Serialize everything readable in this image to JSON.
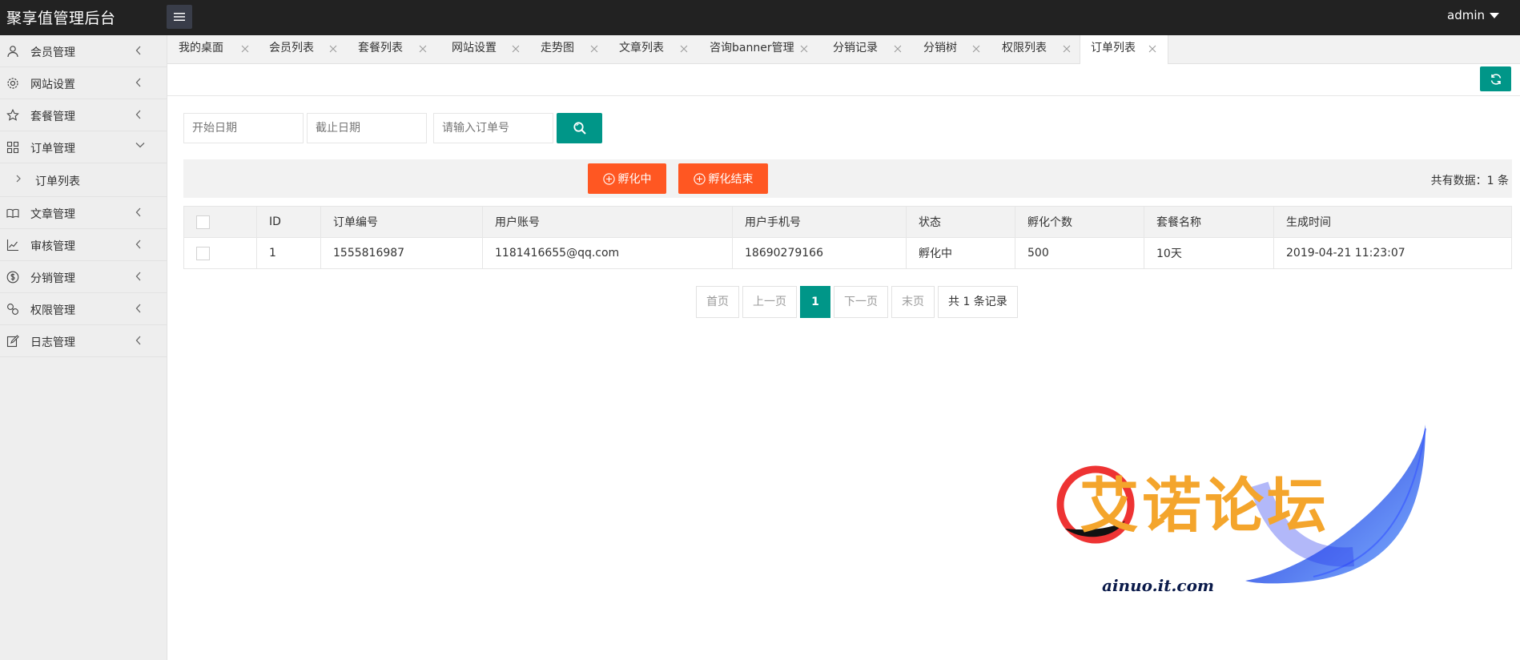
{
  "header": {
    "title": "聚享值管理后台",
    "user": "admin"
  },
  "sidebar": {
    "items": [
      {
        "label": "会员管理",
        "icon": "user-icon"
      },
      {
        "label": "网站设置",
        "icon": "gear-icon"
      },
      {
        "label": "套餐管理",
        "icon": "star-icon"
      },
      {
        "label": "订单管理",
        "icon": "grid-icon",
        "expanded": true
      },
      {
        "label": "文章管理",
        "icon": "book-icon"
      },
      {
        "label": "审核管理",
        "icon": "chart-icon"
      },
      {
        "label": "分销管理",
        "icon": "dollar-icon"
      },
      {
        "label": "权限管理",
        "icon": "link-icon"
      },
      {
        "label": "日志管理",
        "icon": "edit-icon"
      }
    ],
    "sub": {
      "label": "订单列表"
    }
  },
  "tabs": [
    {
      "label": "我的桌面"
    },
    {
      "label": "会员列表"
    },
    {
      "label": "套餐列表"
    },
    {
      "label": "网站设置"
    },
    {
      "label": "走势图"
    },
    {
      "label": "文章列表"
    },
    {
      "label": "咨询banner管理"
    },
    {
      "label": "分销记录"
    },
    {
      "label": "分销树"
    },
    {
      "label": "权限列表"
    },
    {
      "label": "订单列表",
      "active": true
    }
  ],
  "search": {
    "start_placeholder": "开始日期",
    "end_placeholder": "截止日期",
    "order_placeholder": "请输入订单号"
  },
  "actions": {
    "incubating": "孵化中",
    "finished": "孵化结束",
    "count": "共有数据：1 条"
  },
  "table": {
    "headers": [
      "ID",
      "订单编号",
      "用户账号",
      "用户手机号",
      "状态",
      "孵化个数",
      "套餐名称",
      "生成时间"
    ],
    "rows": [
      {
        "id": "1",
        "order_no": "1555816987",
        "account": "1181416655@qq.com",
        "phone": "18690279166",
        "status": "孵化中",
        "count": "500",
        "package": "10天",
        "created": "2019-04-21 11:23:07"
      }
    ]
  },
  "pager": {
    "first": "首页",
    "prev": "上一页",
    "current": "1",
    "next": "下一页",
    "last": "末页",
    "total": "共 1 条记录"
  },
  "watermark": {
    "title": "艾诺论坛",
    "url": "ainuo.it.com"
  },
  "colors": {
    "header": "#222222",
    "primary": "#009688",
    "orange": "#ff5722",
    "sidebar": "#eeeeee"
  }
}
